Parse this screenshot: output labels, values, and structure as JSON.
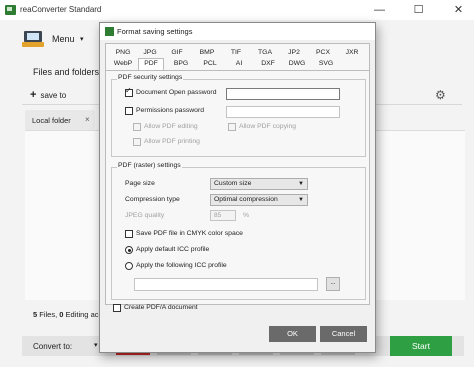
{
  "app": {
    "title": "reaConverter Standard",
    "menu_label": "Menu",
    "files_folders_label": "Files and folders",
    "save_to_label": "save to",
    "local_folder_tab": "Local folder",
    "status": {
      "files_count": "5",
      "files_word": "Files,",
      "editing_count": "0",
      "editing_word": "Editing ac"
    },
    "convert_to_label": "Convert to:",
    "start_button": "Start",
    "window_controls": {
      "minimize": "—",
      "maximize": "☐",
      "close": "✕"
    },
    "colors": {
      "start": "#2ea043",
      "format_chip": "#c62828"
    }
  },
  "dialog": {
    "title": "Format saving settings",
    "tabs_row1": [
      "PNG",
      "JPG",
      "GIF",
      "BMP",
      "TIF",
      "TGA",
      "JP2",
      "PCX",
      "JXR"
    ],
    "tabs_row2": [
      "WebP",
      "PDF",
      "BPG",
      "PCL",
      "AI",
      "DXF",
      "DWG",
      "SVG"
    ],
    "active_tab": "PDF",
    "security": {
      "title": "PDF security settings",
      "open_password_label": "Document Open password",
      "open_password_checked": true,
      "permissions_password_label": "Permissions password",
      "permissions_password_checked": false,
      "allow_editing_label": "Allow PDF editing",
      "allow_copying_label": "Allow PDF copying",
      "allow_printing_label": "Allow PDF printing"
    },
    "raster": {
      "title": "PDF (raster) settings",
      "page_size_label": "Page size",
      "page_size_value": "Custom size",
      "compression_label": "Compression type",
      "compression_value": "Optimal compression",
      "jpeg_quality_label": "JPEG quality",
      "jpeg_quality_value": "85",
      "jpeg_quality_unit": "%",
      "cmyk_label": "Save PDF file in CMYK color space",
      "cmyk_checked": false,
      "icc_default_label": "Apply default ICC profile",
      "icc_following_label": "Apply the following ICC profile",
      "icc_selected": "default",
      "browse_label": "..."
    },
    "create_pdfa_label": "Create PDF/A document",
    "create_pdfa_checked": false,
    "ok_button": "OK",
    "cancel_button": "Cancel"
  }
}
